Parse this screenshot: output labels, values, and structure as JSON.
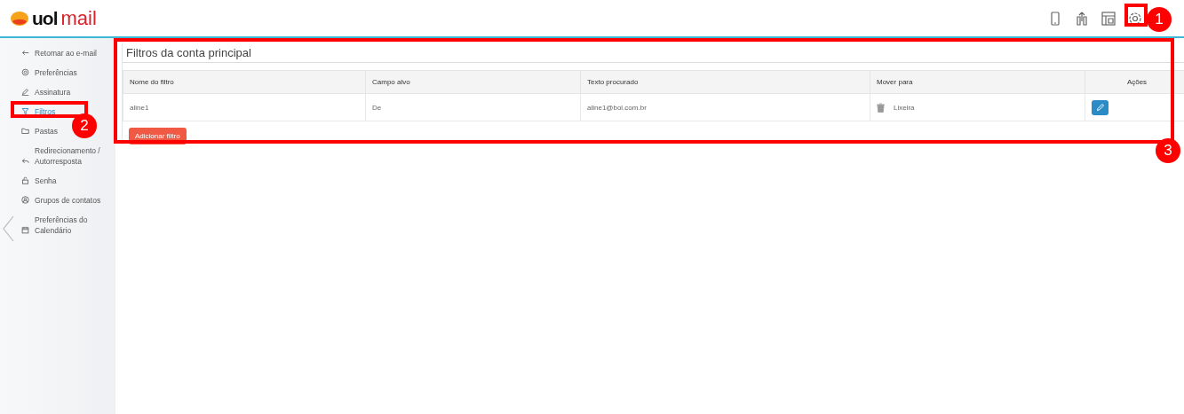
{
  "header": {
    "logo": {
      "brand": "uol",
      "product": "mail"
    }
  },
  "sidebar": {
    "items": [
      {
        "label": "Retomar ao e-mail",
        "selected": false
      },
      {
        "label": "Preferências",
        "selected": false
      },
      {
        "label": "Assinatura",
        "selected": false
      },
      {
        "label": "Filtros",
        "selected": true
      },
      {
        "label": "Pastas",
        "selected": false
      },
      {
        "label": "Redirecionamento / Autorresposta",
        "selected": false
      },
      {
        "label": "Senha",
        "selected": false
      },
      {
        "label": "Grupos de contatos",
        "selected": false
      },
      {
        "label": "Preferências do Calendário",
        "selected": false
      }
    ]
  },
  "panel": {
    "title": "Filtros da conta principal",
    "table": {
      "columns": [
        "Nome do filtro",
        "Campo alvo",
        "Texto procurado",
        "Mover para",
        "Ações"
      ],
      "rows": [
        {
          "name": "aline1",
          "field": "De",
          "text": "aline1@bol.com.br",
          "folder": "Lixeira"
        }
      ]
    },
    "add_button": "Adicionar filtro"
  },
  "annotations": [
    {
      "label": "1"
    },
    {
      "label": "2"
    },
    {
      "label": "3"
    }
  ]
}
